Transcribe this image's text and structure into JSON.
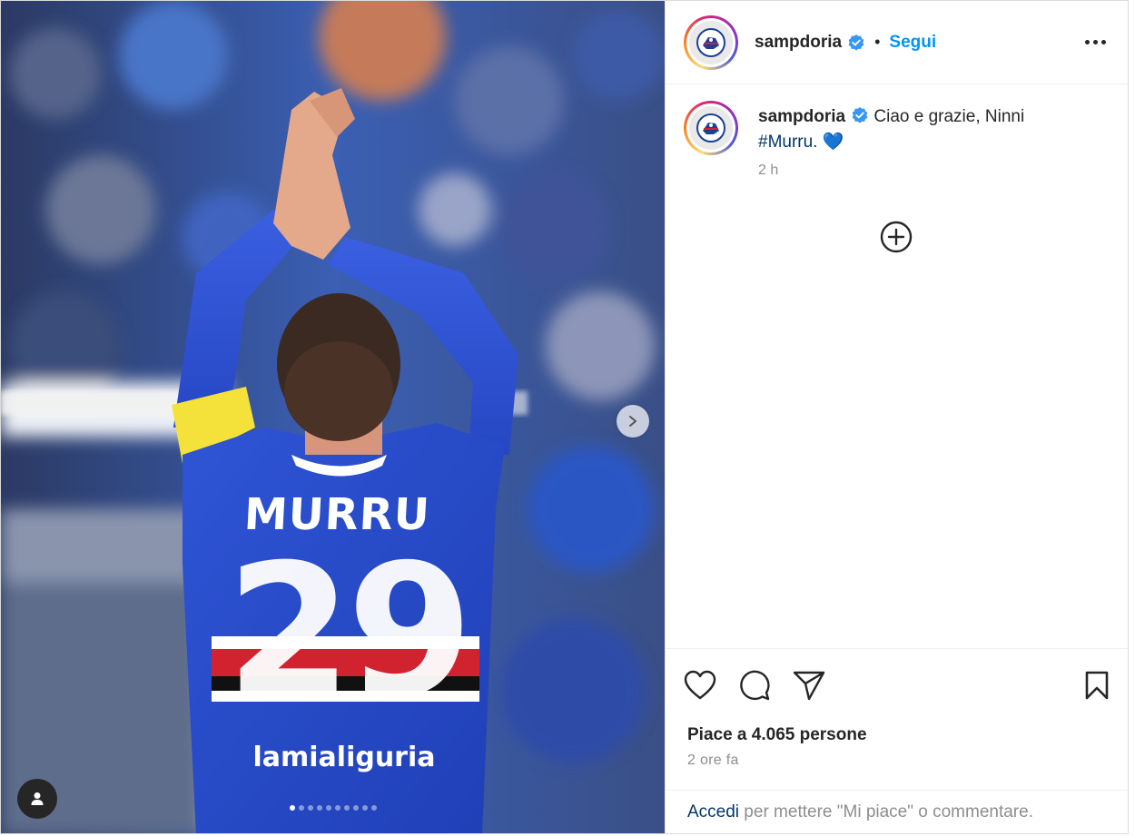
{
  "colors": {
    "accent": "#0095f6",
    "hashtag": "#00376b",
    "text": "#262626",
    "muted": "#8e8e8e",
    "verified": "#3897f0",
    "border": "#dbdbdb"
  },
  "header": {
    "username": "sampdoria",
    "separator": "•",
    "follow_label": "Segui",
    "more_icon": "more-horizontal-icon"
  },
  "caption": {
    "username": "sampdoria",
    "text": "Ciao e grazie, Ninni",
    "hashtag": "#Murru.",
    "emoji": "💙",
    "time": "2 h"
  },
  "media": {
    "jersey_name": "MURRU",
    "jersey_number": "29",
    "sponsor": "lamialiguria",
    "carousel": {
      "total_slides": 10,
      "active_index": 0
    }
  },
  "actions": {
    "like_icon": "heart-icon",
    "comment_icon": "comment-icon",
    "share_icon": "share-icon",
    "save_icon": "bookmark-icon",
    "likes_text": "Piace a 4.065 persone",
    "time_text": "2 ore fa"
  },
  "footer": {
    "login_link": "Accedi",
    "login_text": " per mettere \"Mi piace\" o commentare."
  }
}
